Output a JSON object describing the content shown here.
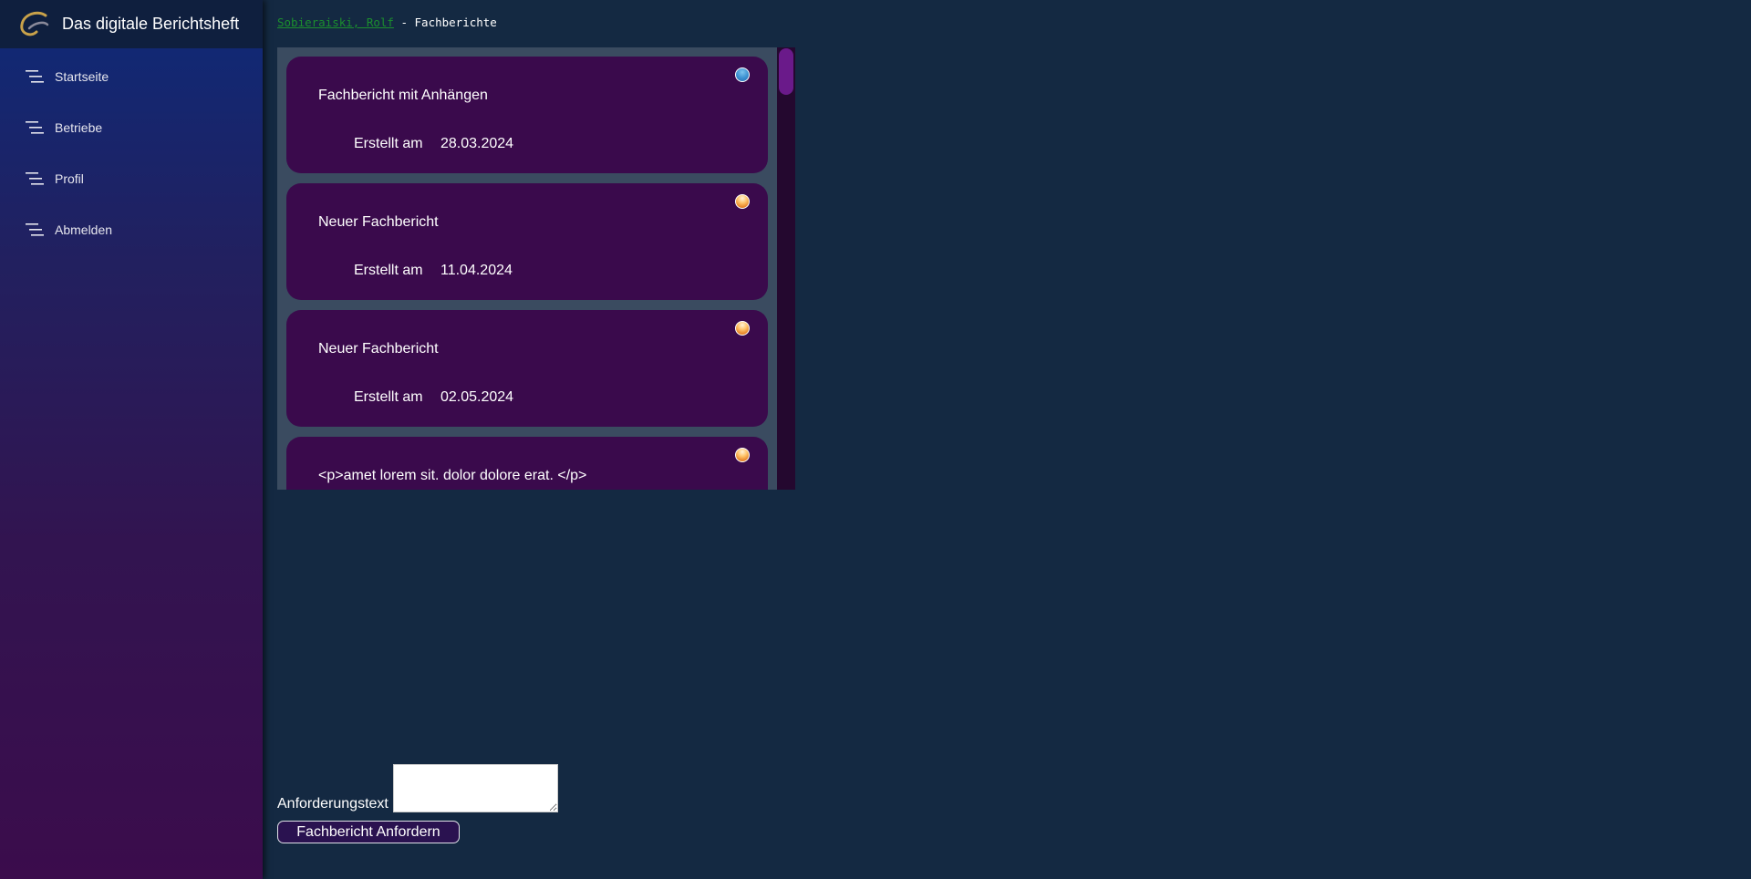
{
  "app": {
    "title": "Das digitale Berichtsheft"
  },
  "sidebar": {
    "items": [
      {
        "label": "Startseite"
      },
      {
        "label": "Betriebe"
      },
      {
        "label": "Profil"
      },
      {
        "label": "Abmelden"
      }
    ]
  },
  "breadcrumb": {
    "user": "Sobieraiski, Rolf",
    "separator": " - ",
    "page": "Fachberichte"
  },
  "reports": [
    {
      "title": "Fachbericht mit Anhängen",
      "created_label": "Erstellt am",
      "created_date": "28.03.2024",
      "status_color": "#3a8fd0"
    },
    {
      "title": "Neuer Fachbericht",
      "created_label": "Erstellt am",
      "created_date": "11.04.2024",
      "status_color": "#e8862a"
    },
    {
      "title": "Neuer Fachbericht",
      "created_label": "Erstellt am",
      "created_date": "02.05.2024",
      "status_color": "#e8862a"
    },
    {
      "title": "<p>amet lorem sit. dolor dolore erat. </p>",
      "created_label": "",
      "created_date": "",
      "status_color": "#e8862a"
    }
  ],
  "request": {
    "label": "Anforderungstext",
    "value": "",
    "button_label": "Fachbericht Anfordern"
  },
  "colors": {
    "background": "#142942",
    "card": "#3a0a4c",
    "link": "#1b8f2e",
    "status_blue": "#3a8fd0",
    "status_orange": "#e8862a"
  },
  "icons": {
    "logo": "swoosh-logo-icon",
    "nav": "menu-lines-icon",
    "status": "status-dot-icon"
  }
}
